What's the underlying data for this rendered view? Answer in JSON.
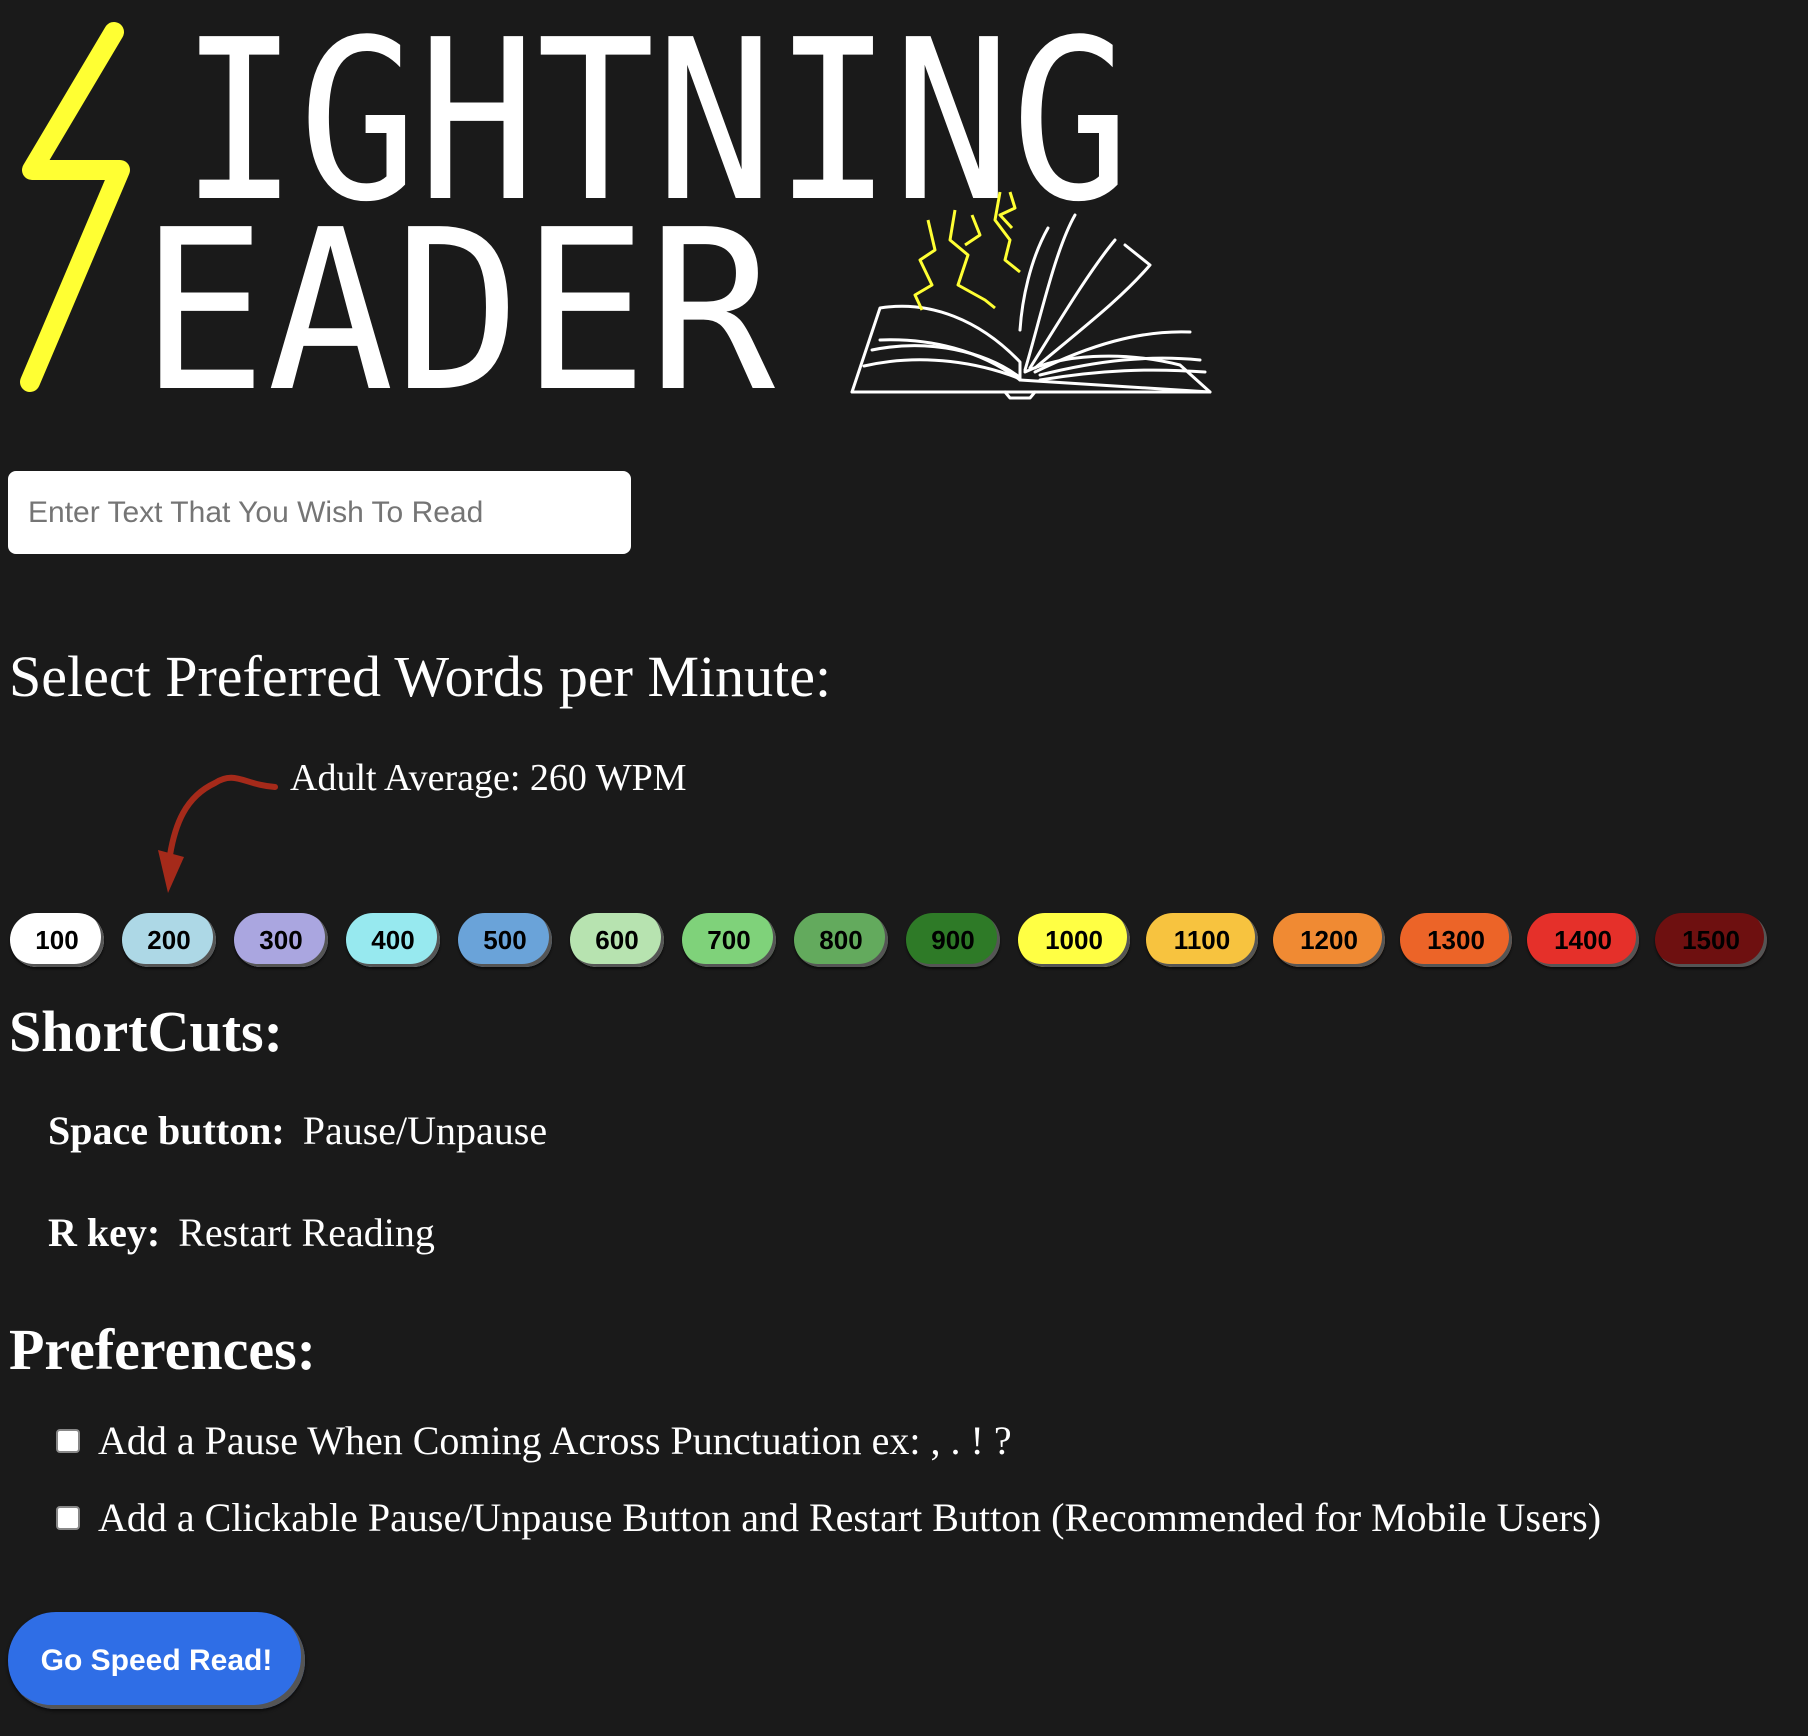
{
  "logo": {
    "line1": "IGHTNING",
    "line2": "EADER",
    "bolt_color": "#ffff33"
  },
  "search": {
    "placeholder": "Enter Text That You Wish To Read"
  },
  "wpm": {
    "heading": "Select Preferred Words per Minute:",
    "adult_average": "Adult Average: 260 WPM",
    "options": [
      {
        "label": "100",
        "color": "#ffffff",
        "text": "#000000"
      },
      {
        "label": "200",
        "color": "#add8e6",
        "text": "#000000"
      },
      {
        "label": "300",
        "color": "#aaa6e0",
        "text": "#000000"
      },
      {
        "label": "400",
        "color": "#97e9ef",
        "text": "#000000"
      },
      {
        "label": "500",
        "color": "#6aa3d9",
        "text": "#000000"
      },
      {
        "label": "600",
        "color": "#b7e3b0",
        "text": "#000000"
      },
      {
        "label": "700",
        "color": "#7fd27a",
        "text": "#000000"
      },
      {
        "label": "800",
        "color": "#63aa5d",
        "text": "#000000"
      },
      {
        "label": "900",
        "color": "#2e7a27",
        "text": "#000000"
      },
      {
        "label": "1000",
        "color": "#ffff44",
        "text": "#000000"
      },
      {
        "label": "1100",
        "color": "#f7c33f",
        "text": "#000000"
      },
      {
        "label": "1200",
        "color": "#f08a33",
        "text": "#000000"
      },
      {
        "label": "1300",
        "color": "#ec6428",
        "text": "#000000"
      },
      {
        "label": "1400",
        "color": "#e5302a",
        "text": "#000000"
      },
      {
        "label": "1500",
        "color": "#6e1010",
        "text": "#000000"
      }
    ]
  },
  "shortcuts": {
    "title": "ShortCuts:",
    "items": [
      {
        "key": "Space button:",
        "desc": "Pause/Unpause"
      },
      {
        "key": "R key:",
        "desc": "Restart Reading"
      }
    ]
  },
  "preferences": {
    "title": "Preferences:",
    "items": [
      {
        "label": "Add a Pause When Coming Across Punctuation ex: , . ! ?"
      },
      {
        "label": "Add a Clickable Pause/Unpause Button and Restart Button (Recommended for Mobile Users)"
      }
    ]
  },
  "go_button": {
    "label": "Go Speed Read!"
  }
}
